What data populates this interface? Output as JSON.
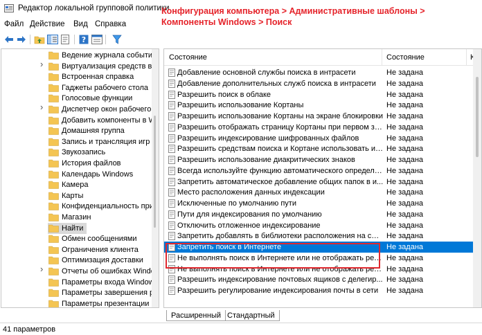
{
  "window": {
    "title": "Редактор локальной групповой политики",
    "annotation": "Конфигурация компьютера > Административные шаблоны > Компоненты Windows > Поиск"
  },
  "menu": [
    "Файл",
    "Действие",
    "Вид",
    "Справка"
  ],
  "toolbar": {
    "buttons": [
      "back-arrow-icon",
      "forward-arrow-icon",
      "up-folder-icon",
      "show-hide-tree-icon",
      "export-list-icon",
      "help-icon",
      "properties-view-icon",
      "filter-icon"
    ]
  },
  "tree": {
    "items": [
      {
        "label": "Ведение журнала событий",
        "expandable": false
      },
      {
        "label": "Виртуализация средств взаи",
        "expandable": true
      },
      {
        "label": "Встроенная справка",
        "expandable": false
      },
      {
        "label": "Гаджеты рабочего стола",
        "expandable": false
      },
      {
        "label": "Голосовые функции",
        "expandable": false
      },
      {
        "label": "Диспетчер окон рабочего с",
        "expandable": true
      },
      {
        "label": "Добавить компоненты в Wi",
        "expandable": false
      },
      {
        "label": "Домашняя группа",
        "expandable": false
      },
      {
        "label": "Запись и трансляция игр W",
        "expandable": false
      },
      {
        "label": "Звукозапись",
        "expandable": false
      },
      {
        "label": "История файлов",
        "expandable": false
      },
      {
        "label": "Календарь Windows",
        "expandable": false
      },
      {
        "label": "Камера",
        "expandable": false
      },
      {
        "label": "Карты",
        "expandable": false
      },
      {
        "label": "Конфиденциальность прил",
        "expandable": false
      },
      {
        "label": "Магазин",
        "expandable": false
      },
      {
        "label": "Найти",
        "expandable": false,
        "selected": true
      },
      {
        "label": "Обмен сообщениями",
        "expandable": false
      },
      {
        "label": "Ограничения клиента",
        "expandable": false
      },
      {
        "label": "Оптимизация доставки",
        "expandable": false
      },
      {
        "label": "Отчеты об ошибках Window",
        "expandable": true
      },
      {
        "label": "Параметры входа Windows",
        "expandable": false
      },
      {
        "label": "Параметры завершения ра",
        "expandable": false
      },
      {
        "label": "Параметры презентации",
        "expandable": false
      }
    ]
  },
  "list": {
    "columns": {
      "name": "Состояние",
      "state": "Состояние",
      "comment": "К"
    },
    "rows": [
      {
        "name": "Добавление основной службы поиска в интрасети",
        "state": "Не задана"
      },
      {
        "name": "Добавление дополнительных служб поиска в интрасети",
        "state": "Не задана"
      },
      {
        "name": "Разрешить поиск в облаке",
        "state": "Не задана"
      },
      {
        "name": "Разрешить использование Кортаны",
        "state": "Не задана"
      },
      {
        "name": "Разрешить использование Кортаны на экране блокировки",
        "state": "Не задана"
      },
      {
        "name": "Разрешить отображать страницу Кортаны при первом за...",
        "state": "Не задана"
      },
      {
        "name": "Разрешить индексирование шифрованных файлов",
        "state": "Не задана"
      },
      {
        "name": "Разрешить средствам поиска и Кортане использовать ин...",
        "state": "Не задана"
      },
      {
        "name": "Разрешить использование диакритических знаков",
        "state": "Не задана"
      },
      {
        "name": "Всегда используйте функцию автоматического определе...",
        "state": "Не задана"
      },
      {
        "name": "Запретить автоматическое добавление общих папок в и...",
        "state": "Не задана"
      },
      {
        "name": "Место расположения данных индексации",
        "state": "Не задана"
      },
      {
        "name": "Исключенные по умолчанию пути",
        "state": "Не задана"
      },
      {
        "name": "Пути для индексирования по умолчанию",
        "state": "Не задана"
      },
      {
        "name": "Отключить отложенное индексирование",
        "state": "Не задана"
      },
      {
        "name": "Запретить добавлять в библиотеки расположения на съе...",
        "state": "Не задана"
      },
      {
        "name": "Запретить поиск в Интернете",
        "state": "Не задана",
        "selected": true
      },
      {
        "name": "Не выполнять поиск в Интернете или не отображать рез...",
        "state": "Не задана"
      },
      {
        "name": "Не выполнять поиск в Интернете или не отображать рез...",
        "state": "Не задана"
      },
      {
        "name": "Разрешить индексирование почтовых ящиков с делегир...",
        "state": "Не задана"
      },
      {
        "name": "Разрешить регулирование индексирования почты в сети",
        "state": "Не задана"
      }
    ]
  },
  "tabs": [
    "Расширенный",
    "Стандартный"
  ],
  "status": {
    "text": "41 параметров"
  },
  "colors": {
    "selection": "#0078d7",
    "annotation": "#e5232a",
    "folder": "#f4c553"
  }
}
